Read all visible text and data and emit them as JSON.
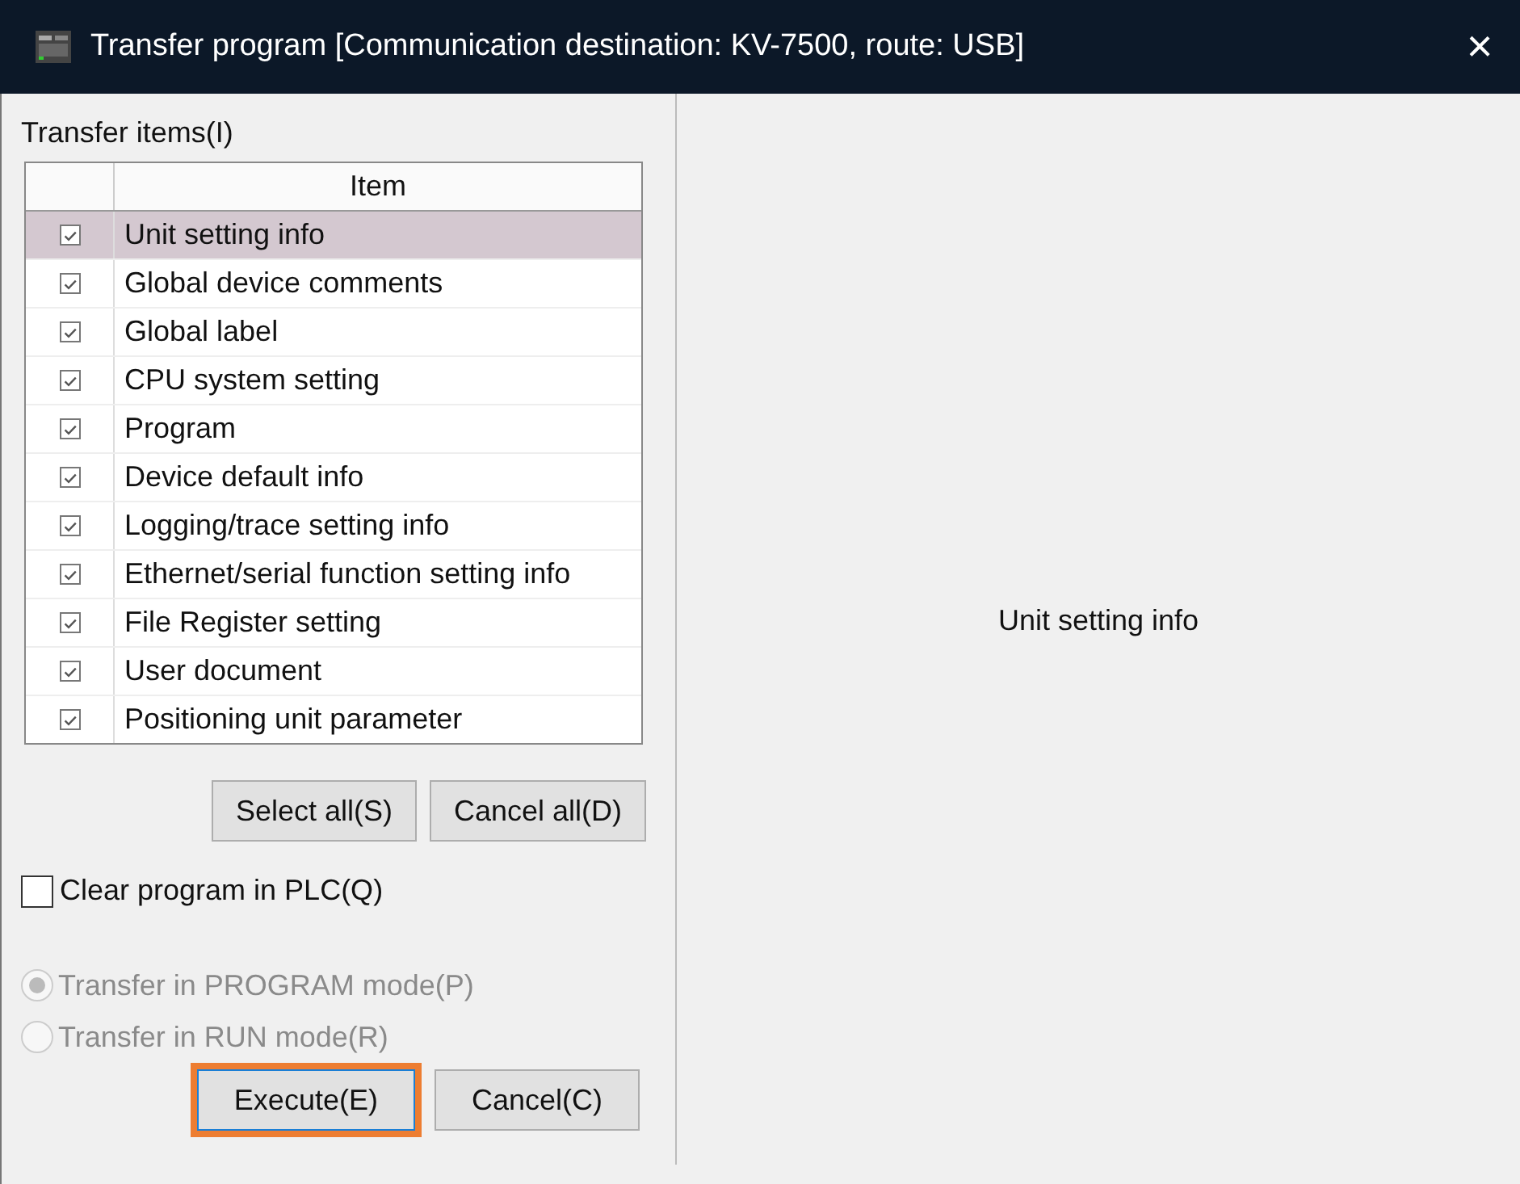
{
  "window": {
    "title": "Transfer program [Communication destination: KV-7500, route: USB]",
    "close": "×"
  },
  "transfer_items": {
    "label": "Transfer items(I)",
    "columns": [
      "Item"
    ],
    "rows": [
      {
        "name": "Unit setting info",
        "checked": true,
        "selected": true
      },
      {
        "name": "Global device comments",
        "checked": true,
        "selected": false
      },
      {
        "name": "Global label",
        "checked": true,
        "selected": false
      },
      {
        "name": "CPU system setting",
        "checked": true,
        "selected": false
      },
      {
        "name": "Program",
        "checked": true,
        "selected": false
      },
      {
        "name": "Device default info",
        "checked": true,
        "selected": false
      },
      {
        "name": "Logging/trace setting info",
        "checked": true,
        "selected": false
      },
      {
        "name": "Ethernet/serial function setting info",
        "checked": true,
        "selected": false
      },
      {
        "name": "File Register setting",
        "checked": true,
        "selected": false
      },
      {
        "name": "User document",
        "checked": true,
        "selected": false
      },
      {
        "name": "Positioning unit parameter",
        "checked": true,
        "selected": false
      }
    ]
  },
  "list_buttons": [
    "Select all(S)",
    "Cancel all(D)"
  ],
  "clear_program": {
    "label": "Clear program in PLC(Q)",
    "checked": false
  },
  "modes": [
    {
      "label": "Transfer in PROGRAM mode(P)",
      "selected": true,
      "disabled": true
    },
    {
      "label": "Transfer in RUN mode(R)",
      "selected": false,
      "disabled": true
    }
  ],
  "buttons": [
    {
      "label": "Execute(E)",
      "highlighted": true
    },
    {
      "label": "Cancel(C)",
      "highlighted": false
    }
  ],
  "detail": {
    "text": "Unit setting info"
  }
}
